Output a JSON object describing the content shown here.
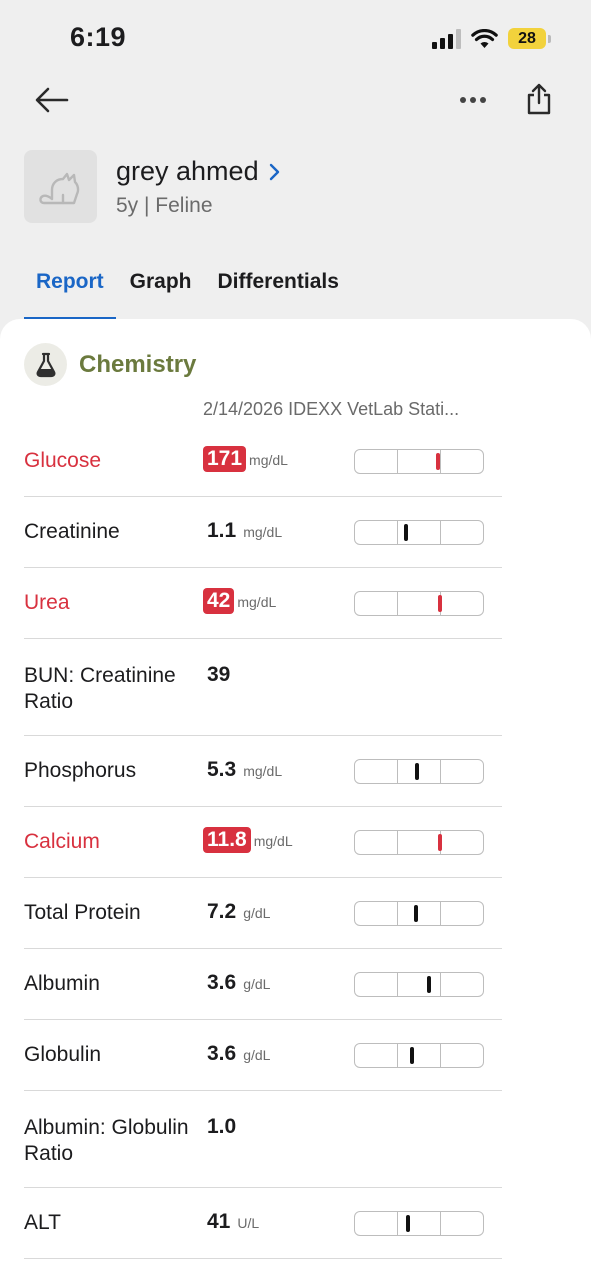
{
  "status_bar": {
    "time": "6:19",
    "battery": "28"
  },
  "patient": {
    "name": "grey ahmed",
    "meta": "5y | Feline"
  },
  "tabs": [
    {
      "label": "Report",
      "active": true
    },
    {
      "label": "Graph",
      "active": false
    },
    {
      "label": "Differentials",
      "active": false
    }
  ],
  "section": {
    "title": "Chemistry",
    "run_header": "2/14/2026 IDEXX VetLab Stati..."
  },
  "colors": {
    "accent": "#1a66c6",
    "abnormal": "#d8313f",
    "section_title": "#6b7a3e",
    "battery": "#f2d23c"
  },
  "results": [
    {
      "name": "Glucose",
      "value": "171",
      "unit": "mg/dL",
      "abnormal": true,
      "range_fraction": 0.65
    },
    {
      "name": "Creatinine",
      "value": "1.1",
      "unit": "mg/dL",
      "abnormal": false,
      "range_fraction": 0.4
    },
    {
      "name": "Urea",
      "value": "42",
      "unit": "mg/dL",
      "abnormal": true,
      "range_fraction": 0.67
    },
    {
      "name": "BUN: Creatinine Ratio",
      "value": "39",
      "unit": "",
      "abnormal": false,
      "range_fraction": null
    },
    {
      "name": "Phosphorus",
      "value": "5.3",
      "unit": "mg/dL",
      "abnormal": false,
      "range_fraction": 0.49
    },
    {
      "name": "Calcium",
      "value": "11.8",
      "unit": "mg/dL",
      "abnormal": true,
      "range_fraction": 0.67
    },
    {
      "name": "Total Protein",
      "value": "7.2",
      "unit": "g/dL",
      "abnormal": false,
      "range_fraction": 0.48
    },
    {
      "name": "Albumin",
      "value": "3.6",
      "unit": "g/dL",
      "abnormal": false,
      "range_fraction": 0.58
    },
    {
      "name": "Globulin",
      "value": "3.6",
      "unit": "g/dL",
      "abnormal": false,
      "range_fraction": 0.45
    },
    {
      "name": "Albumin: Globulin Ratio",
      "value": "1.0",
      "unit": "",
      "abnormal": false,
      "range_fraction": null
    },
    {
      "name": "ALT",
      "value": "41",
      "unit": "U/L",
      "abnormal": false,
      "range_fraction": 0.42
    }
  ],
  "icons": {
    "back": "arrow-left-icon",
    "more": "more-horizontal-icon",
    "share": "share-icon",
    "avatar": "cat-icon",
    "chevron": "chevron-right-icon",
    "section": "flask-icon"
  }
}
